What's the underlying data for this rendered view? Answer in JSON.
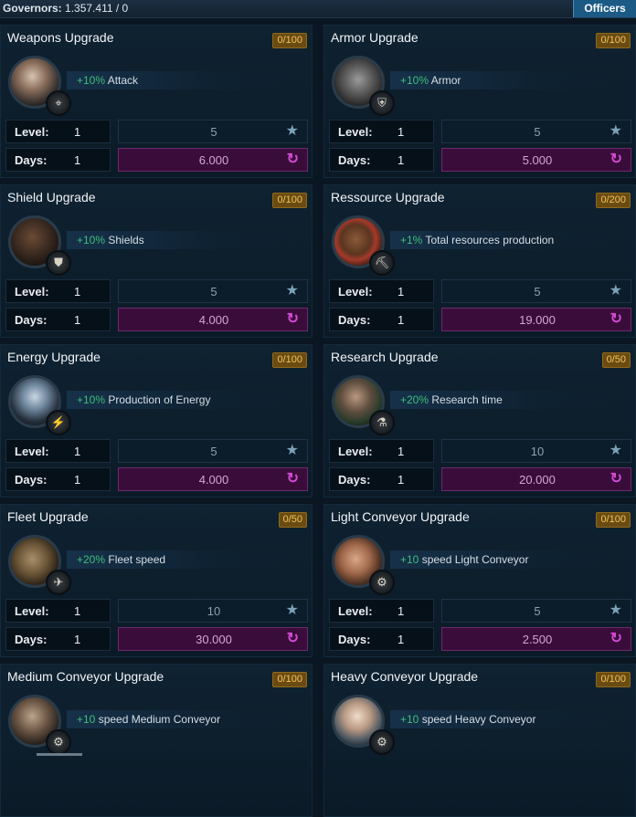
{
  "header": {
    "governors_label": "Governors:",
    "governors_value": "1.357.411 / 0",
    "officers_label": "Officers"
  },
  "cards": [
    {
      "title": "Weapons Upgrade",
      "badge": "0/100",
      "bonus_pct": "+10%",
      "bonus_text": "Attack",
      "level_label": "Level:",
      "level": "1",
      "level_cost": "5",
      "days_label": "Days:",
      "days": "1",
      "days_cost": "6.000",
      "emblem": "crosshair-icon"
    },
    {
      "title": "Armor Upgrade",
      "badge": "0/100",
      "bonus_pct": "+10%",
      "bonus_text": "Armor",
      "level_label": "Level:",
      "level": "1",
      "level_cost": "5",
      "days_label": "Days:",
      "days": "1",
      "days_cost": "5.000",
      "emblem": "armor-icon"
    },
    {
      "title": "Shield Upgrade",
      "badge": "0/100",
      "bonus_pct": "+10%",
      "bonus_text": "Shields",
      "level_label": "Level:",
      "level": "1",
      "level_cost": "5",
      "days_label": "Days:",
      "days": "1",
      "days_cost": "4.000",
      "emblem": "shield-icon"
    },
    {
      "title": "Ressource Upgrade",
      "badge": "0/200",
      "bonus_pct": "+1%",
      "bonus_text": "Total resources production",
      "level_label": "Level:",
      "level": "1",
      "level_cost": "5",
      "days_label": "Days:",
      "days": "1",
      "days_cost": "19.000",
      "emblem": "resource-icon"
    },
    {
      "title": "Energy Upgrade",
      "badge": "0/100",
      "bonus_pct": "+10%",
      "bonus_text": "Production of Energy",
      "level_label": "Level:",
      "level": "1",
      "level_cost": "5",
      "days_label": "Days:",
      "days": "1",
      "days_cost": "4.000",
      "emblem": "energy-icon"
    },
    {
      "title": "Research Upgrade",
      "badge": "0/50",
      "bonus_pct": "+20%",
      "bonus_text": "Research time",
      "level_label": "Level:",
      "level": "1",
      "level_cost": "10",
      "days_label": "Days:",
      "days": "1",
      "days_cost": "20.000",
      "emblem": "research-icon"
    },
    {
      "title": "Fleet Upgrade",
      "badge": "0/50",
      "bonus_pct": "+20%",
      "bonus_text": "Fleet speed",
      "level_label": "Level:",
      "level": "1",
      "level_cost": "10",
      "days_label": "Days:",
      "days": "1",
      "days_cost": "30.000",
      "emblem": "fleet-icon"
    },
    {
      "title": "Light Conveyor Upgrade",
      "badge": "0/100",
      "bonus_pct": "+10",
      "bonus_text": "speed Light Conveyor",
      "level_label": "Level:",
      "level": "1",
      "level_cost": "5",
      "days_label": "Days:",
      "days": "1",
      "days_cost": "2.500",
      "emblem": "gear-icon"
    },
    {
      "title": "Medium Conveyor Upgrade",
      "badge": "0/100",
      "bonus_pct": "+10",
      "bonus_text": "speed Medium Conveyor",
      "emblem": "gear-icon"
    },
    {
      "title": "Heavy Conveyor Upgrade",
      "badge": "0/100",
      "bonus_pct": "+10",
      "bonus_text": "speed Heavy Conveyor",
      "emblem": "gear-icon"
    }
  ],
  "colors": {
    "accent": "#1c5a86",
    "badge": "#f2c35a",
    "bonus_pct": "#3fbf7a",
    "days_bg": "#3a0c3a",
    "days_icon": "#d24cd4"
  }
}
